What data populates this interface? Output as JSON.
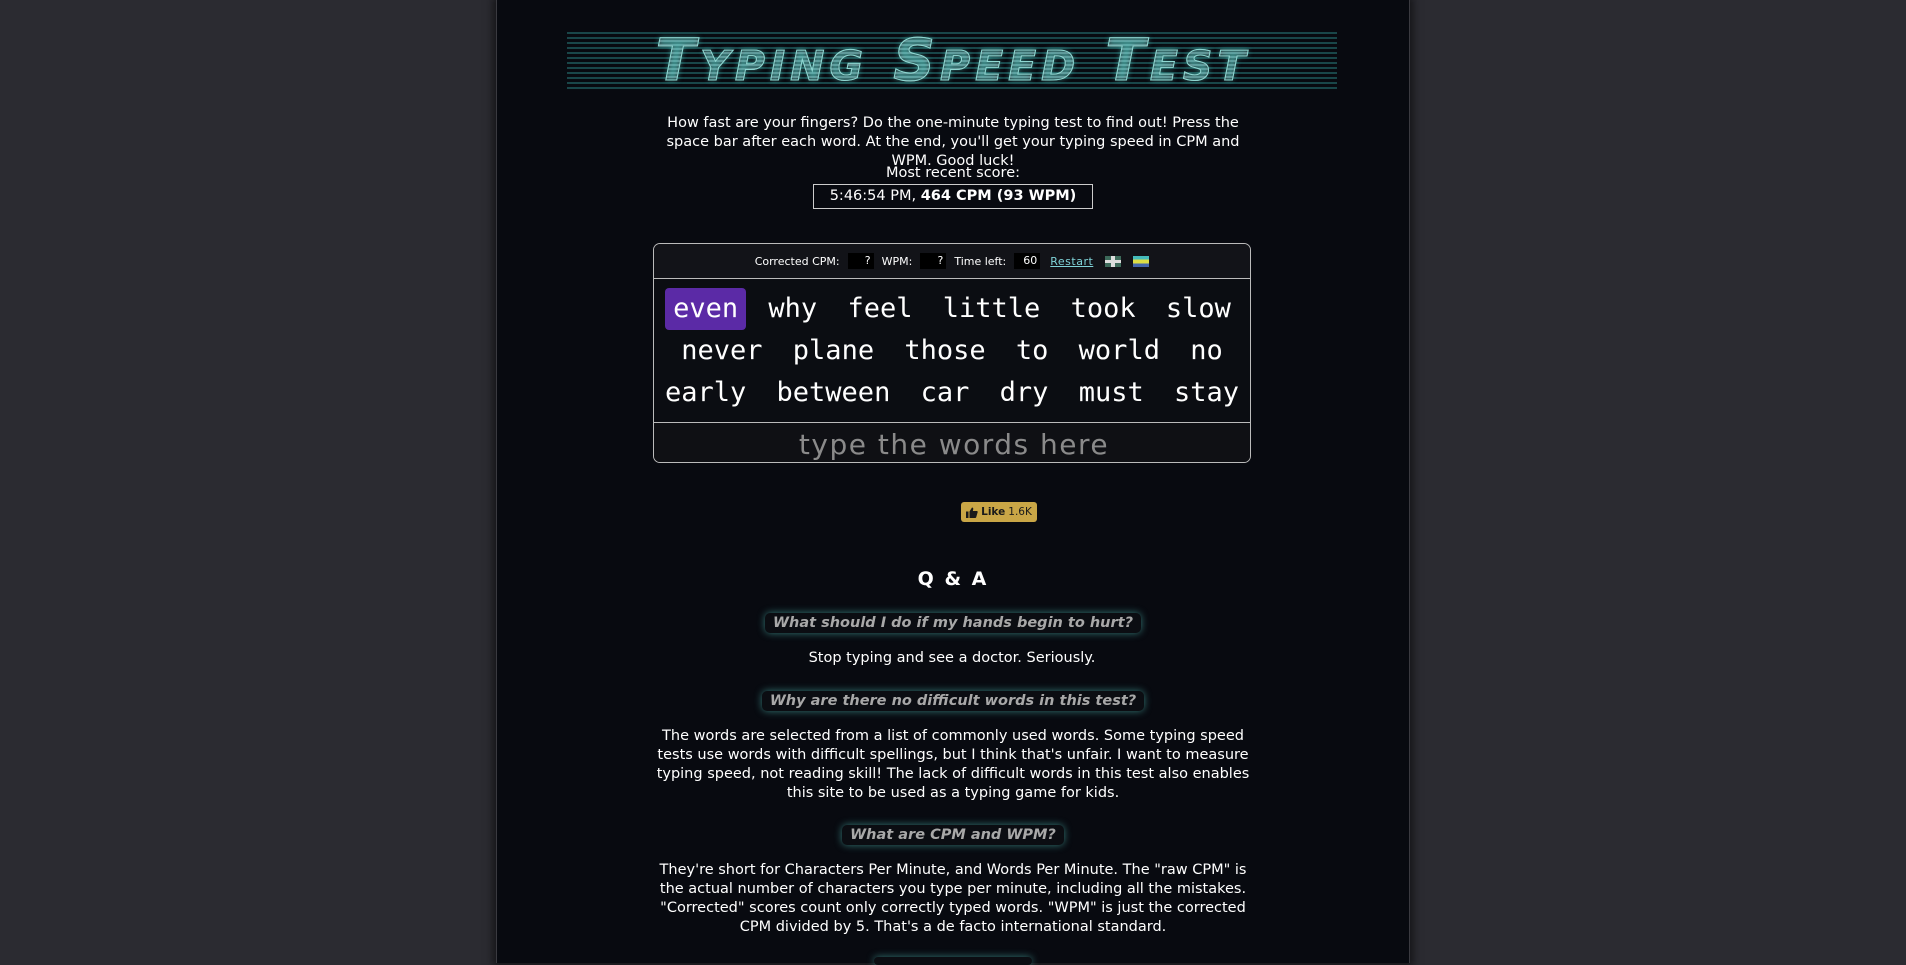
{
  "title": "Typing Speed Test",
  "intro": "How fast are your fingers? Do the one-minute typing test to find out! Press the space bar after each word. At the end, you'll get your typing speed in CPM and WPM. Good luck!",
  "recent": {
    "label": "Most recent score:",
    "time": "5:46:54 PM,",
    "score": "464 CPM (93 WPM)"
  },
  "stats": {
    "cpm_label": "Corrected CPM:",
    "cpm_value": "?",
    "wpm_label": "WPM:",
    "wpm_value": "?",
    "time_label": "Time left:",
    "time_value": "60",
    "restart": "Restart"
  },
  "words": [
    [
      "even",
      "why",
      "feel",
      "little",
      "took",
      "slow"
    ],
    [
      "never",
      "plane",
      "those",
      "to",
      "world",
      "no"
    ],
    [
      "early",
      "between",
      "car",
      "dry",
      "must",
      "stay"
    ]
  ],
  "input": {
    "placeholder": "type the words here"
  },
  "like": {
    "label": "Like",
    "count": "1.6K"
  },
  "qa": {
    "title": "Q & A",
    "items": [
      {
        "q": "What should I do if my hands begin to hurt?",
        "a": "Stop typing and see a doctor. Seriously."
      },
      {
        "q": "Why are there no difficult words in this test?",
        "a": "The words are selected from a list of commonly used words. Some typing speed tests use words with difficult spellings, but I think that's unfair. I want to measure typing speed, not reading skill! The lack of difficult words in this test also enables this site to be used as a typing game for kids."
      },
      {
        "q": "What are CPM and WPM?",
        "a": "They're short for Characters Per Minute, and Words Per Minute. The \"raw CPM\" is the actual number of characters you type per minute, including all the mistakes. \"Corrected\" scores count only correctly typed words. \"WPM\" is just the corrected CPM divided by 5. That's a de facto international standard."
      }
    ]
  },
  "colors": {
    "highlight": "#5b2aa6",
    "accent": "#7fd3d8",
    "glow": "#5ad2c8"
  }
}
